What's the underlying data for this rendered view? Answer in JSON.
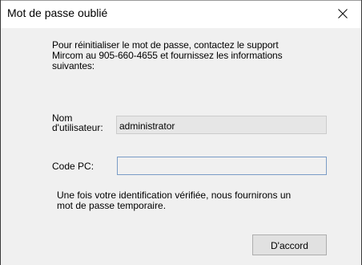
{
  "dialog": {
    "title": "Mot de passe oublié",
    "close_icon": "close-icon"
  },
  "content": {
    "instructions_line1": "Pour réinitialiser le mot de passe, contactez le support",
    "instructions_line2": "Mircom au 905-660-4655 et fournissez les informations",
    "instructions_line3": "suivantes:",
    "username_label_line1": "Nom",
    "username_label_line2": "d'utilisateur:",
    "username_value": "administrator",
    "pc_code_label": "Code PC:",
    "pc_code_value": "",
    "confirmation_line1": "Une fois votre identification vérifiée, nous fournirons un",
    "confirmation_line2": "mot de passe temporaire."
  },
  "buttons": {
    "ok_label": "D'accord"
  },
  "colors": {
    "client_background": "#f0f0f0",
    "title_background": "#ffffff",
    "input_focus_border": "#7a9cc6",
    "button_background": "#e1e1e1"
  }
}
